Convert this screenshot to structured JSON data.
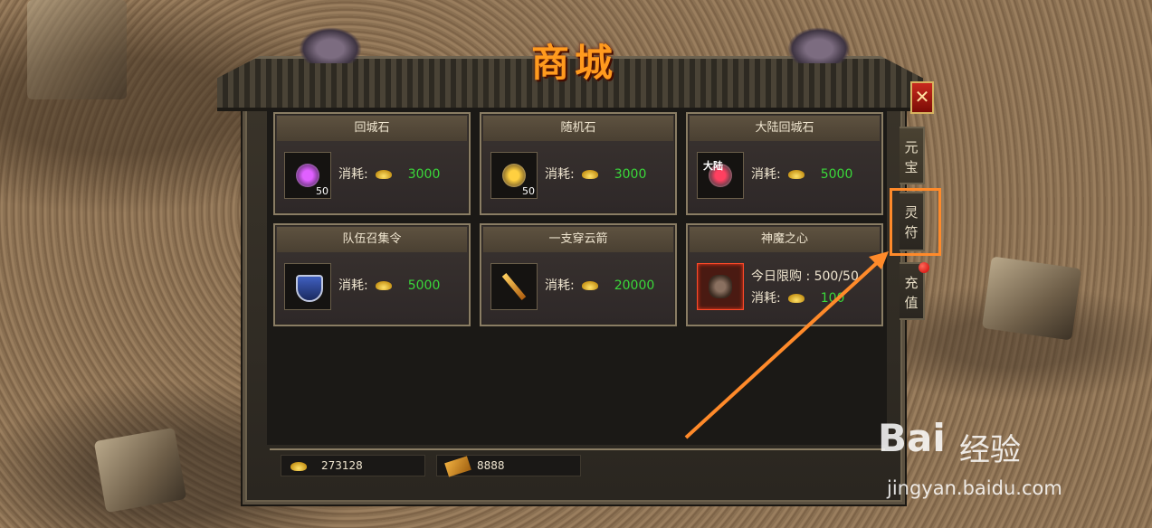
{
  "window": {
    "title": "商城",
    "close_label": "✕"
  },
  "items": [
    {
      "name": "回城石",
      "icon": "purple-spiral-stone",
      "quantity": "50",
      "cost_label": "消耗:",
      "price": "3000"
    },
    {
      "name": "随机石",
      "icon": "gold-spiral-stone",
      "quantity": "50",
      "cost_label": "消耗:",
      "price": "3000"
    },
    {
      "name": "大陆回城石",
      "icon": "red-spiral-stone",
      "icon_label": "大陆",
      "cost_label": "消耗:",
      "price": "5000"
    },
    {
      "name": "队伍召集令",
      "icon": "blue-shield-badge",
      "cost_label": "消耗:",
      "price": "5000"
    },
    {
      "name": "一支穿云箭",
      "icon": "golden-arrow",
      "cost_label": "消耗:",
      "price": "20000"
    },
    {
      "name": "神魔之心",
      "icon": "dark-heart-stone",
      "limit_label": "今日限购 : 500/50",
      "cost_label": "消耗:",
      "price": "100"
    }
  ],
  "tabs": [
    {
      "label": "元\n宝",
      "active": true
    },
    {
      "label": "灵\n符",
      "active": false
    },
    {
      "label": "充\n值",
      "active": false
    }
  ],
  "currency": {
    "ingot": "273128",
    "ticket": "8888"
  },
  "watermark": {
    "brand": "Bai",
    "brand2": "经验",
    "url": "jingyan.baidu.com"
  },
  "colors": {
    "price": "#3ad83a",
    "highlight": "#ff8a2a",
    "title": "#ff9a1e"
  }
}
